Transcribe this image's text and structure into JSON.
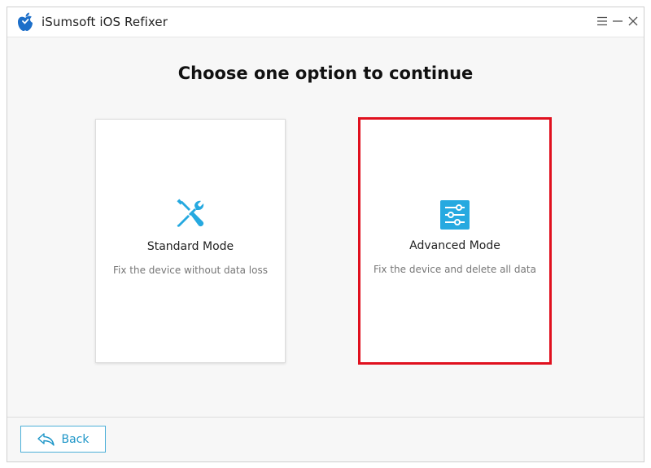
{
  "window": {
    "title": "iSumsoft iOS Refixer",
    "controls": {
      "menu": "menu-icon",
      "minimize": "minimize-icon",
      "close": "close-icon"
    }
  },
  "main": {
    "heading": "Choose one option to continue",
    "options": [
      {
        "title": "Standard Mode",
        "description": "Fix the device without data loss",
        "icon": "wrench-screwdriver-icon",
        "selected": false
      },
      {
        "title": "Advanced Mode",
        "description": "Fix the device and delete all data",
        "icon": "sliders-icon",
        "selected": true
      }
    ]
  },
  "footer": {
    "back_label": "Back",
    "back_icon": "back-arrow-icon"
  },
  "colors": {
    "accent": "#26a9e0",
    "selection_border": "#e0101e",
    "back_text": "#1e96c8"
  }
}
